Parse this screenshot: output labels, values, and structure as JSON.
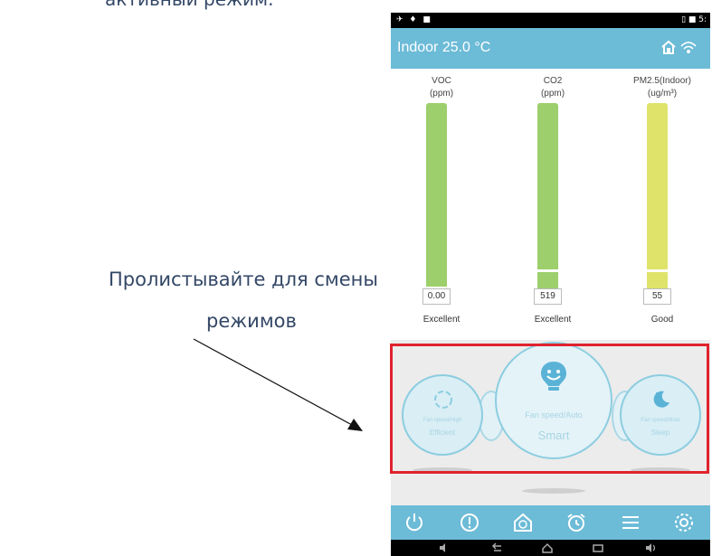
{
  "page_caption_top_partial": "активный режим.",
  "callout_line1": "Пролистывайте для смены",
  "callout_line2": "режимов",
  "app": {
    "title": "Indoor 25.0 °C",
    "status_left": "✈ ♦ ■",
    "status_right": "▯ ■ 5:"
  },
  "gauges": [
    {
      "label1": "VOC",
      "label2": "(ppm)",
      "value": "0.00",
      "rating": "Excellent",
      "color": "#9dcf6c",
      "level": 0.0
    },
    {
      "label1": "CO2",
      "label2": "(ppm)",
      "value": "519",
      "rating": "Excellent",
      "color": "#9dcf6c",
      "level": 0.1
    },
    {
      "label1": "PM2.5(Indoor)",
      "label2": "(ug/m³)",
      "value": "55",
      "rating": "Good",
      "color": "#dfe36a",
      "level": 0.1
    }
  ],
  "modes": {
    "efficient": {
      "sub": "Fan speed/High",
      "label": "Efficient"
    },
    "smart": {
      "sub": "Fan speed/Auto",
      "label": "Smart"
    },
    "sleep": {
      "sub": "Fan speed/Mute",
      "label": "Sleep"
    }
  },
  "toolbar_icons": [
    "power-icon",
    "alert-icon",
    "home-fan-icon",
    "alarm-clock-icon",
    "menu-icon",
    "settings-icon"
  ],
  "colors": {
    "accent": "#6cbbd7",
    "highlight": "#e0232d",
    "good_bar": "#9dcf6c",
    "moderate_bar": "#dfe36a"
  }
}
